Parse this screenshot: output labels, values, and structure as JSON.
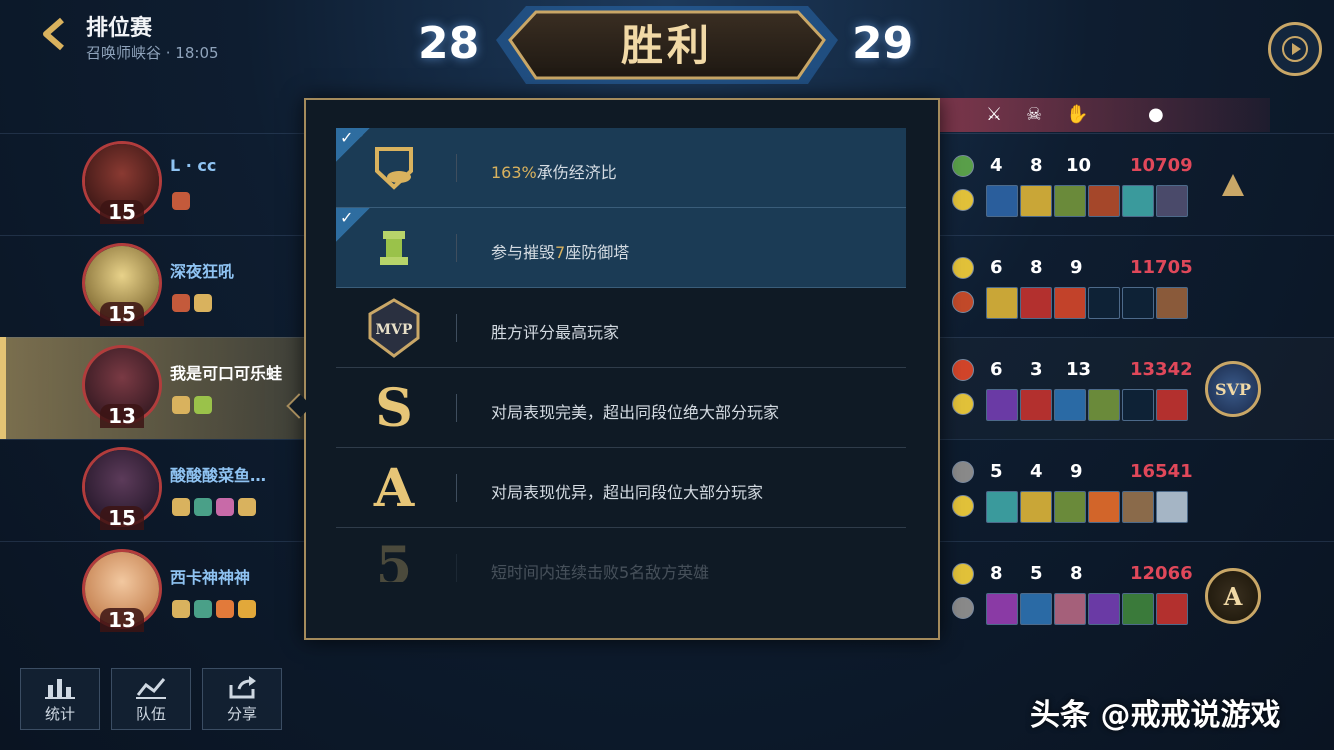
{
  "header": {
    "title": "排位赛",
    "subtitle": "召唤师峡谷 · 18:05",
    "score_left": "28",
    "result": "胜利",
    "score_right": "29"
  },
  "players": [
    {
      "name": "L · cc",
      "level": "15",
      "kills": "4",
      "deaths": "8",
      "assists": "10",
      "gold": "10709",
      "honor": ""
    },
    {
      "name": "深夜狂吼",
      "level": "15",
      "kills": "6",
      "deaths": "8",
      "assists": "9",
      "gold": "11705",
      "honor": ""
    },
    {
      "name": "我是可口可乐蛙",
      "level": "13",
      "kills": "6",
      "deaths": "3",
      "assists": "13",
      "gold": "13342",
      "honor": "SVP"
    },
    {
      "name": "酸酸酸菜鱼…",
      "level": "15",
      "kills": "5",
      "deaths": "4",
      "assists": "9",
      "gold": "16541",
      "honor": ""
    },
    {
      "name": "西卡神神神",
      "level": "13",
      "kills": "8",
      "deaths": "5",
      "assists": "8",
      "gold": "12066",
      "honor": "A"
    }
  ],
  "popup": {
    "rows": [
      {
        "icon": "shield-coin-icon",
        "highlight": "163%",
        "text": "承伤经济比",
        "checked": true
      },
      {
        "icon": "tower-icon",
        "pre": "参与摧毁",
        "highlight": "7",
        "post": "座防御塔",
        "checked": true
      },
      {
        "icon": "mvp-badge-icon",
        "badge": "MVP",
        "text": "胜方评分最高玩家",
        "checked": false
      },
      {
        "icon": "grade-s-icon",
        "badge": "S",
        "text": "对局表现完美，超出同段位绝大部分玩家",
        "checked": false
      },
      {
        "icon": "grade-a-icon",
        "badge": "A",
        "text": "对局表现优异，超出同段位大部分玩家",
        "checked": false
      },
      {
        "icon": "five-kill-icon",
        "badge": "5",
        "text": "短时间内连续击败5名敌方英雄",
        "checked": false
      }
    ]
  },
  "buttons": {
    "stats": "统计",
    "team": "队伍",
    "share": "分享"
  },
  "watermark": "头条 @戒戒说游戏",
  "colors": {
    "accent_gold": "#d9b25e",
    "gold_text": "#e0485a",
    "name_blue": "#8fc3f2"
  }
}
